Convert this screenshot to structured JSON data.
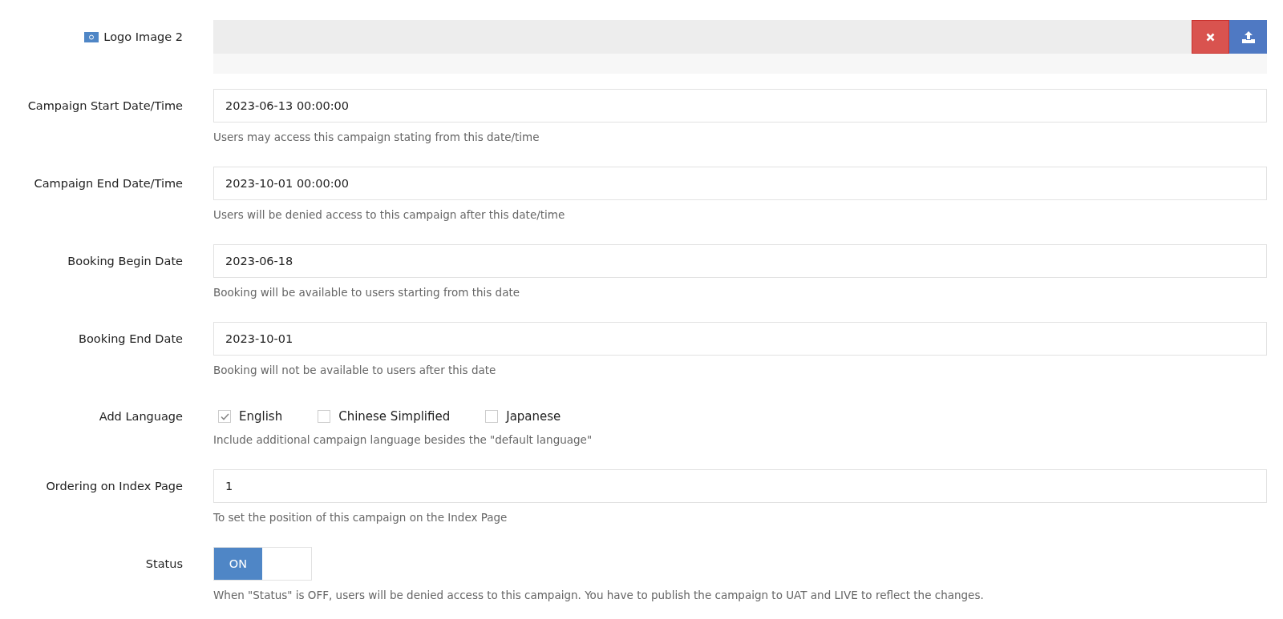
{
  "fields": [
    {
      "kind": "upload",
      "label": "Logo Image 2"
    },
    {
      "kind": "text",
      "label": "Campaign Start Date/Time",
      "value": "2023-06-13 00:00:00",
      "help": "Users may access this campaign stating from this date/time"
    },
    {
      "kind": "text",
      "label": "Campaign End Date/Time",
      "value": "2023-10-01 00:00:00",
      "help": "Users will be denied access to this campaign after this date/time"
    },
    {
      "kind": "text",
      "label": "Booking Begin Date",
      "value": "2023-06-18",
      "help": "Booking will be available to users starting from this date"
    },
    {
      "kind": "text",
      "label": "Booking End Date",
      "value": "2023-10-01",
      "help": "Booking will not be available to users after this date"
    },
    {
      "kind": "checkboxes",
      "label": "Add Language",
      "options": [
        {
          "label": "English",
          "checked": true
        },
        {
          "label": "Chinese Simplified",
          "checked": false
        },
        {
          "label": "Japanese",
          "checked": false
        }
      ],
      "help": "Include additional campaign language besides the \"default language\""
    },
    {
      "kind": "text",
      "label": "Ordering on Index Page",
      "value": "1",
      "help": "To set the position of this campaign on the Index Page"
    },
    {
      "kind": "toggle",
      "label": "Status",
      "on": true,
      "on_text": "ON",
      "help": "When \"Status\" is OFF, users will be denied access to this campaign. You have to publish the campaign to UAT and LIVE to reflect the changes."
    }
  ]
}
